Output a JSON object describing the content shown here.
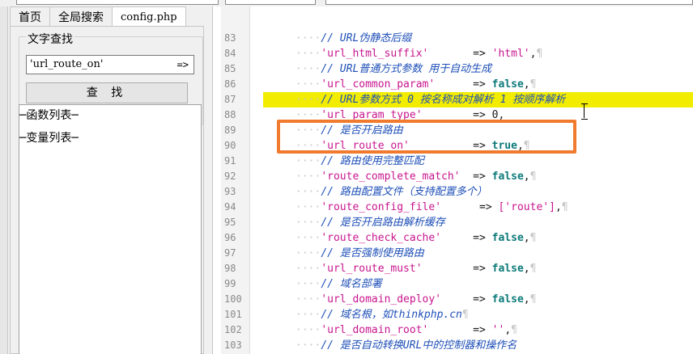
{
  "tabs": [
    "首页",
    "全局搜索",
    "config.php"
  ],
  "search": {
    "group_title": "文字查找",
    "input_value": "'url_route_on'",
    "input_arrow": "=>",
    "button_label": "查 找"
  },
  "lists": {
    "functions": "─函数列表─",
    "variables": "─变量列表─"
  },
  "editor": {
    "lines": [
      {
        "n": "83",
        "dots": "····",
        "comment": "// URL伪静态后缀",
        "pil": ""
      },
      {
        "n": "84",
        "dots": "····",
        "key": "'url_html_suffix'",
        "pad": "       ",
        "arrow": "=>",
        "val": "'html'",
        "val_kind": "str",
        "tail": ",",
        "pil": "¶"
      },
      {
        "n": "85",
        "dots": "····",
        "comment": "// URL普通方式参数 用于自动生成",
        "pil": ""
      },
      {
        "n": "86",
        "dots": "····",
        "key": "'url_common_param'",
        "pad": "      ",
        "arrow": "=>",
        "val": "false",
        "val_kind": "kw",
        "tail": ",",
        "pil": "¶"
      },
      {
        "n": "87",
        "dots": "····",
        "comment": "// URL参数方式 0 按名称成对解析 1 按顺序解析",
        "pil": "",
        "hl": true
      },
      {
        "n": "88",
        "dots": "····",
        "key": "'url_param_type'",
        "pad": "        ",
        "arrow": "=>",
        "val": "0",
        "val_kind": "op",
        "tail": ",",
        "pil": ""
      },
      {
        "n": "89",
        "dots": "····",
        "comment": "// 是否开启路由",
        "pil": ""
      },
      {
        "n": "90",
        "dots": "····",
        "key": "'url_route_on'",
        "pad": "          ",
        "arrow": "=>",
        "val": "true",
        "val_kind": "kw",
        "tail": ",",
        "pil": "¶"
      },
      {
        "n": "91",
        "dots": "····",
        "comment": "// 路由使用完整匹配",
        "pil": ""
      },
      {
        "n": "92",
        "dots": "····",
        "key": "'route_complete_match'",
        "pad": "  ",
        "arrow": "=>",
        "val": "false",
        "val_kind": "kw",
        "tail": ",",
        "pil": "¶"
      },
      {
        "n": "93",
        "dots": "····",
        "comment": "// 路由配置文件（支持配置多个）",
        "pil": ""
      },
      {
        "n": "94",
        "dots": "····",
        "key": "'route_config_file'",
        "pad": "      ",
        "arrow": "=>",
        "val": "['route']",
        "val_kind": "str",
        "tail": ",",
        "pil": "¶"
      },
      {
        "n": "95",
        "dots": "····",
        "comment": "// 是否开启路由解析缓存",
        "pil": ""
      },
      {
        "n": "96",
        "dots": "····",
        "key": "'route_check_cache'",
        "pad": "     ",
        "arrow": "=>",
        "val": "false",
        "val_kind": "kw",
        "tail": ",",
        "pil": "¶"
      },
      {
        "n": "97",
        "dots": "····",
        "comment": "// 是否强制使用路由",
        "pil": ""
      },
      {
        "n": "98",
        "dots": "····",
        "key": "'url_route_must'",
        "pad": "        ",
        "arrow": "=>",
        "val": "false",
        "val_kind": "kw",
        "tail": ",",
        "pil": "¶"
      },
      {
        "n": "99",
        "dots": "····",
        "comment": "// 域名部署",
        "pil": ""
      },
      {
        "n": "100",
        "dots": "····",
        "key": "'url_domain_deploy'",
        "pad": "     ",
        "arrow": "=>",
        "val": "false",
        "val_kind": "kw",
        "tail": ",",
        "pil": "¶"
      },
      {
        "n": "101",
        "dots": "····",
        "comment": "// 域名根，如thinkphp.cn",
        "pil": "¶"
      },
      {
        "n": "102",
        "dots": "····",
        "key": "'url_domain_root'",
        "pad": "       ",
        "arrow": "=>",
        "val": "''",
        "val_kind": "str",
        "tail": ",",
        "pil": "¶"
      },
      {
        "n": "103",
        "dots": "····",
        "comment": "// 是否自动转换URL中的控制器和操作名",
        "pil": ""
      }
    ]
  }
}
